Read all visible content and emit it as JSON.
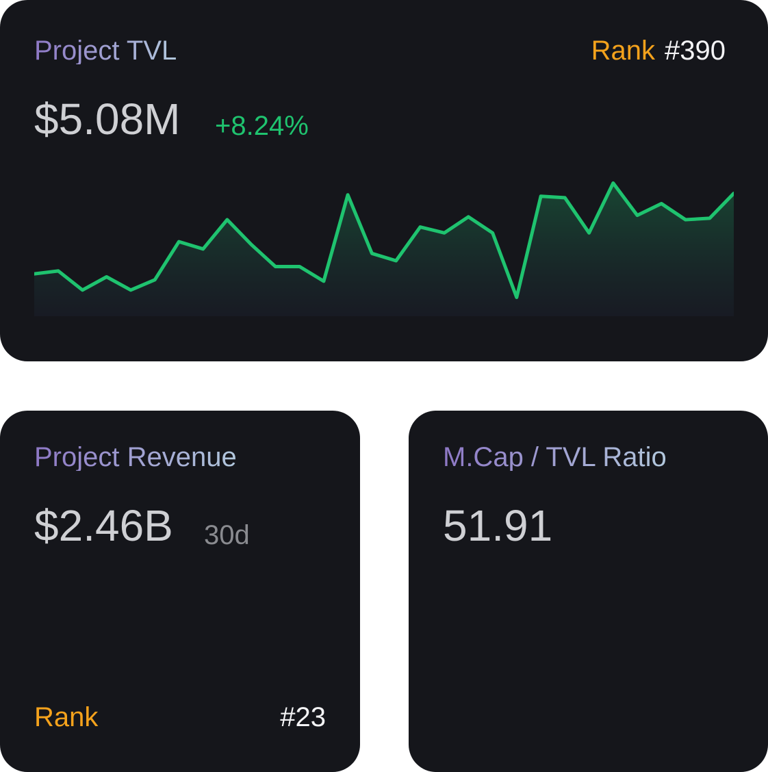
{
  "tvl_card": {
    "title": "Project TVL",
    "rank_label": "Rank",
    "rank_value": "#390",
    "value": "$5.08M",
    "change": "+8.24%",
    "accent_color": "#1fc36f"
  },
  "revenue_card": {
    "title": "Project Revenue",
    "value": "$2.46B",
    "period": "30d",
    "rank_label": "Rank",
    "rank_value": "#23"
  },
  "ratio_card": {
    "title": "M.Cap / TVL Ratio",
    "value": "51.91"
  },
  "colors": {
    "card_background": "#15161b",
    "rank_label": "#f4a21c",
    "title_gradient_start": "#8e78c6",
    "title_gradient_end": "#b2c8dd"
  },
  "chart_data": {
    "type": "area",
    "title": "",
    "xlabel": "",
    "ylabel": "",
    "grid": false,
    "ylim": [
      0,
      100
    ],
    "series": [
      {
        "values": [
          27,
          29,
          16,
          25,
          16,
          23,
          49,
          44,
          64,
          47,
          32,
          32,
          22,
          81,
          41,
          36,
          59,
          55,
          66,
          55,
          11,
          80,
          79,
          55,
          89,
          67,
          75,
          64,
          65,
          82
        ]
      }
    ]
  }
}
